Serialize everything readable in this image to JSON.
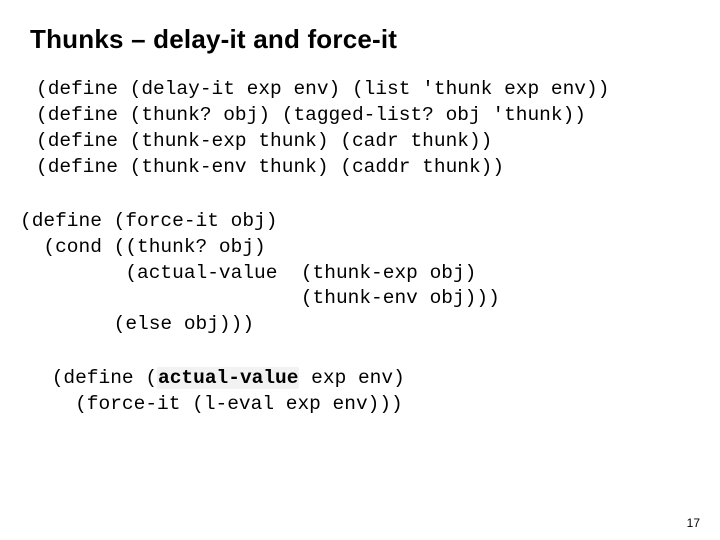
{
  "title": "Thunks – delay-it and force-it",
  "block1": {
    "l1": "(define (delay-it exp env) (list 'thunk exp env))",
    "l2": "(define (thunk? obj) (tagged-list? obj 'thunk))",
    "l3": "(define (thunk-exp thunk) (cadr thunk))",
    "l4": "(define (thunk-env thunk) (caddr thunk))"
  },
  "block2": {
    "l1": "(define (force-it obj)",
    "l2": "  (cond ((thunk? obj)",
    "l3": "         (actual-value  (thunk-exp obj)",
    "l4": "                        (thunk-env obj)))",
    "l5": "        (else obj)))"
  },
  "block3": {
    "l1a": " (define (",
    "l1b": "actual-value",
    "l1c": " exp env)",
    "l2": "   (force-it (l-eval exp env)))"
  },
  "page_number": "17"
}
